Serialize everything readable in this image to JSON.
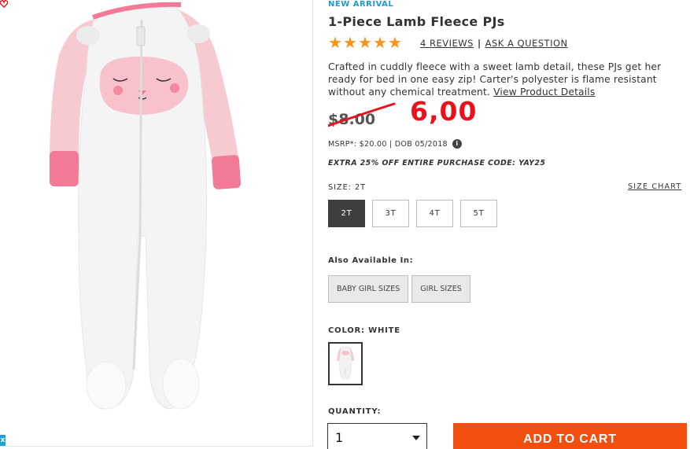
{
  "product": {
    "eyebrow": "NEW ARRIVAL",
    "title": "1-Piece Lamb Fleece PJs",
    "rating": {
      "stars": 5,
      "max": 5
    },
    "reviews_link": "4 REVIEWS",
    "separator": "|",
    "ask_link": "ASK A QUESTION",
    "description": "Crafted in cuddly fleece with a sweet lamb detail, these PJs get her ready for bed in one easy zip! Carter's polyester is flame resistant without any chemical treatment.",
    "details_link": "View Product Details"
  },
  "pricing": {
    "old_price": "$8.00",
    "handwritten_price": "6,00",
    "msrp": "MSRP*: $20.00 | DOB 05/2018",
    "info_icon": "i",
    "promo": "EXTRA 25% OFF ENTIRE PURCHASE CODE: YAY25"
  },
  "size": {
    "label": "SIZE: 2T",
    "chart_link": "SIZE CHART",
    "options": [
      "2T",
      "3T",
      "4T",
      "5T"
    ],
    "selected": "2T"
  },
  "also_available": {
    "label": "Also Available In:",
    "options": [
      "BABY GIRL SIZES",
      "GIRL SIZES"
    ]
  },
  "color": {
    "label": "COLOR: WHITE",
    "swatch": "white-lamb-pj-thumbnail"
  },
  "quantity": {
    "label": "QUANTITY:",
    "value": "1",
    "icon": "chevron-down-icon"
  },
  "cart": {
    "label": "ADD TO CART"
  },
  "colors": {
    "accent_blue": "#1a9bd4",
    "star": "#f7941d",
    "sale_red": "#e8111c",
    "cart_orange": "#f24e0f",
    "selected_size": "#3f3f3f"
  },
  "icons": [
    "heart-icon",
    "close-icon",
    "info-icon",
    "star-icon",
    "chevron-down-icon"
  ]
}
